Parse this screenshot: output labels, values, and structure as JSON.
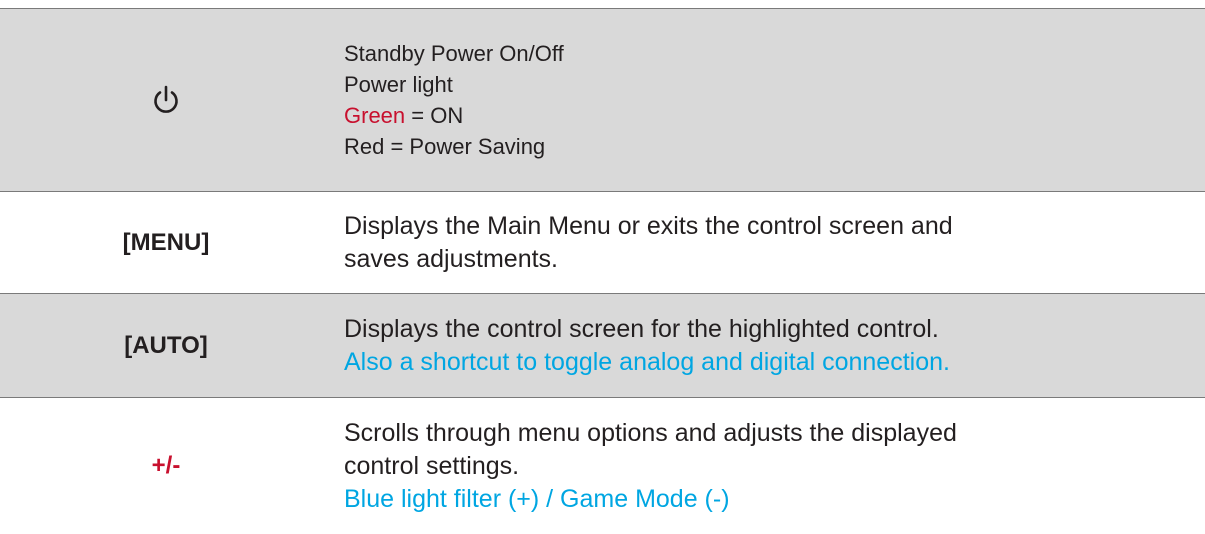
{
  "rows": [
    {
      "key": "power-icon",
      "lines": [
        "Standby Power On/Off",
        "Power light"
      ],
      "green_word": "Green",
      "green_rest": " = ON",
      "last_line": "Red = Power Saving"
    },
    {
      "key": "[MENU]",
      "lines": [
        "Displays the Main Menu or exits the control screen and",
        "saves adjustments."
      ]
    },
    {
      "key": "[AUTO]",
      "lines": [
        "Displays the control screen for the highlighted control."
      ],
      "highlight": "Also a shortcut to toggle analog and digital connection."
    },
    {
      "key": "+/-",
      "lines": [
        "Scrolls through menu options and adjusts the displayed",
        "control settings."
      ],
      "highlight": "Blue light filter (+) / Game Mode (-)"
    }
  ],
  "colors": {
    "shade": "#d9d9d9",
    "rule": "#7a7a7a",
    "text": "#231f20",
    "red": "#c8102e",
    "blue": "#00a6e2"
  }
}
